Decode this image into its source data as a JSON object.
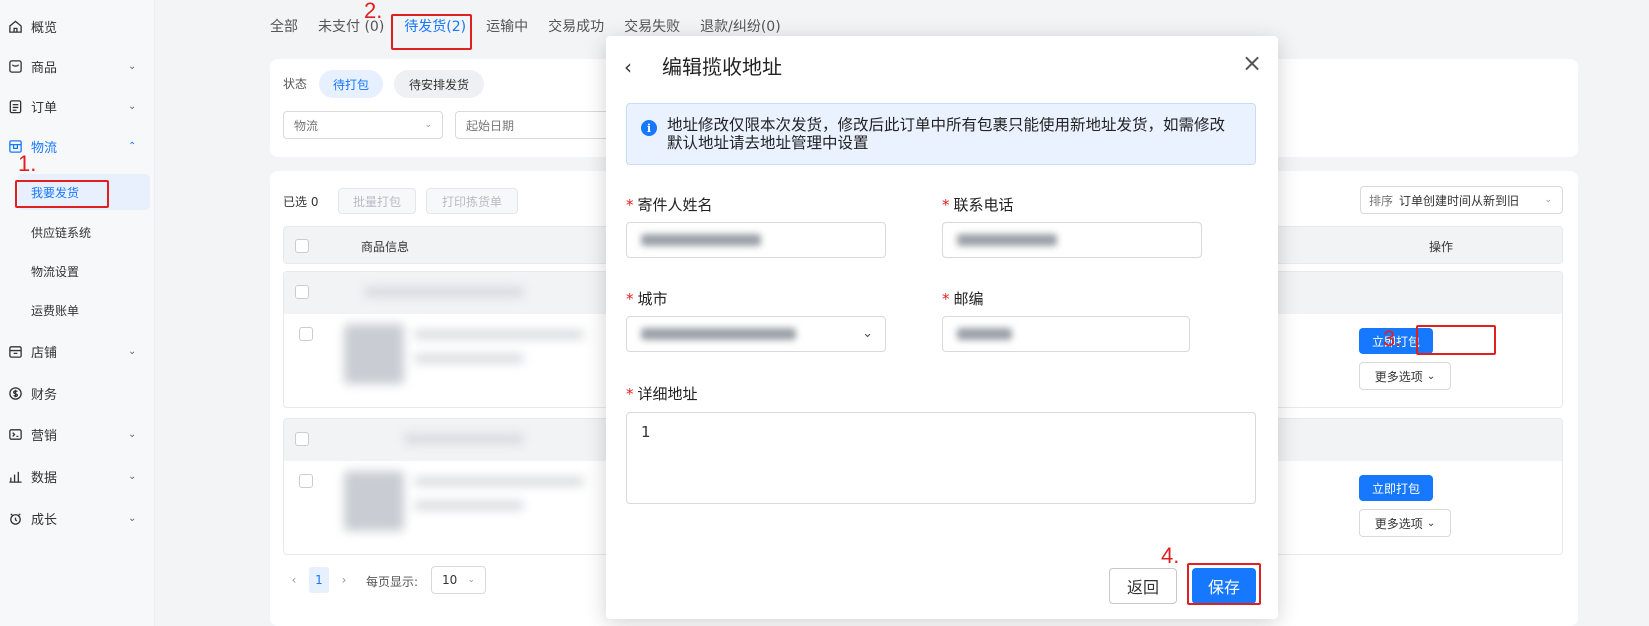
{
  "sidebar": {
    "items": [
      {
        "label": "概览",
        "icon": "home-icon"
      },
      {
        "label": "商品",
        "icon": "product-icon",
        "chevron": "⌄"
      },
      {
        "label": "订单",
        "icon": "order-icon",
        "chevron": "⌄"
      },
      {
        "label": "物流",
        "icon": "logistics-icon",
        "chevron": "⌃"
      },
      {
        "label": "店铺",
        "icon": "store-icon",
        "chevron": "⌄"
      },
      {
        "label": "财务",
        "icon": "finance-icon"
      },
      {
        "label": "营销",
        "icon": "marketing-icon",
        "chevron": "⌄"
      },
      {
        "label": "数据",
        "icon": "data-icon",
        "chevron": "⌄"
      },
      {
        "label": "成长",
        "icon": "growth-icon",
        "chevron": "⌄"
      }
    ],
    "logistics_sub": [
      "我要发货",
      "供应链系统",
      "物流设置",
      "运费账单"
    ]
  },
  "annotations": {
    "step1": "1.",
    "step2": "2.",
    "step3": "3.",
    "step4": "4."
  },
  "tabs": [
    "全部",
    "未支付 (0)",
    "待发货(2)",
    "运输中",
    "交易成功",
    "交易失败",
    "退款/纠纷(0)"
  ],
  "filter": {
    "status_label": "状态",
    "status_options": [
      "待打包",
      "待安排发货"
    ],
    "logistics_placeholder": "物流",
    "start_date_placeholder": "起始日期"
  },
  "orders": {
    "selected_label": "已选 0",
    "batch_pack": "批量打包",
    "print_picklist": "打印拣货单",
    "sort_label": "排序",
    "sort_value": "订单创建时间从新到旧",
    "col_product": "商品信息",
    "col_action": "操作",
    "pack_now": "立即打包",
    "more_options": "更多选项",
    "pager": {
      "prev": "‹",
      "current": "1",
      "next": "›",
      "per_page_label": "每页显示:",
      "per_page_value": "10"
    }
  },
  "modal": {
    "back": "‹",
    "title": "编辑揽收地址",
    "close": "×",
    "alert_icon": "i",
    "alert_text": "地址修改仅限本次发货，修改后此订单中所有包裹只能使用新地址发货，如需修改默认地址请去地址管理中设置",
    "required_mark": "*",
    "sender_name_label": "寄件人姓名",
    "phone_label": "联系电话",
    "city_label": "城市",
    "zip_label": "邮编",
    "address_label": "详细地址",
    "address_value": "1",
    "back_button": "返回",
    "save_button": "保存"
  },
  "colors": {
    "accent": "#1677ff",
    "annotation": "#e02020",
    "required": "#e02020"
  }
}
